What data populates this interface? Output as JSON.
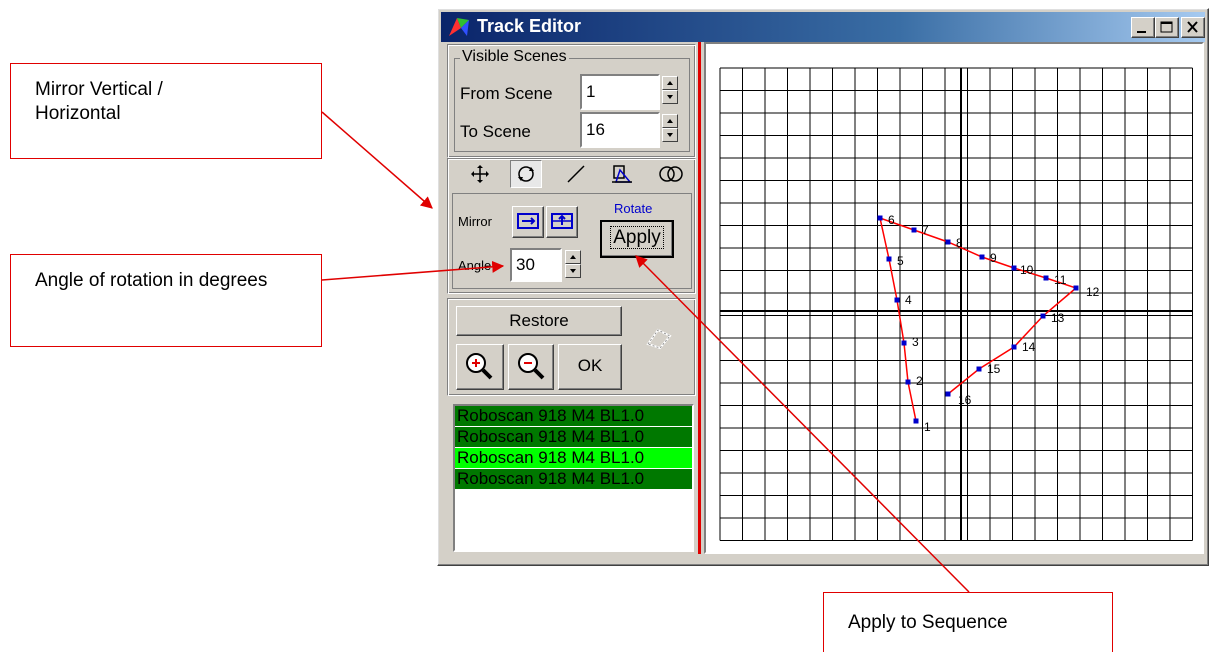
{
  "callouts": {
    "mirror": "Mirror Vertical / Horizontal",
    "angle": "Angle of rotation in degrees",
    "apply": "Apply to Sequence"
  },
  "window": {
    "title": "Track Editor",
    "icons": {
      "app": "app-logo-icon",
      "min": "minimize-icon",
      "max": "maximize-icon",
      "close": "close-icon"
    }
  },
  "visible_scenes": {
    "group_label": "Visible Scenes",
    "from_label": "From Scene",
    "from_value": "1",
    "to_label": "To Scene",
    "to_value": "16"
  },
  "tools": [
    "move-tool-icon",
    "rotate-tool-icon",
    "line-tool-icon",
    "skew-tool-icon",
    "circles-tool-icon"
  ],
  "rotate_panel": {
    "mirror_label": "Mirror",
    "rotate_label": "Rotate",
    "apply_label": "Apply",
    "angle_label": "Angle",
    "angle_value": "30"
  },
  "actions": {
    "restore_label": "Restore",
    "ok_label": "OK",
    "zoom_in": "zoom-in-icon",
    "zoom_out": "zoom-out-icon",
    "preview": "shape-preview-icon"
  },
  "tracks": [
    {
      "label": "Roboscan 918 M4 BL1.0",
      "selected": false
    },
    {
      "label": "Roboscan 918 M4 BL1.0",
      "selected": false
    },
    {
      "label": "Roboscan 918 M4 BL1.0",
      "selected": true
    },
    {
      "label": "Roboscan 918 M4 BL1.0",
      "selected": false
    }
  ],
  "track_points": [
    {
      "label": "1"
    },
    {
      "label": "2"
    },
    {
      "label": "3"
    },
    {
      "label": "4"
    },
    {
      "label": "5"
    },
    {
      "label": "6"
    },
    {
      "label": "7"
    },
    {
      "label": "8"
    },
    {
      "label": "9"
    },
    {
      "label": "10"
    },
    {
      "label": "11"
    },
    {
      "label": "12"
    },
    {
      "label": "13"
    },
    {
      "label": "14"
    },
    {
      "label": "15"
    },
    {
      "label": "16"
    }
  ],
  "colors": {
    "track_line": "#ff0000",
    "point": "#0000cc",
    "grid": "#000000",
    "accent": "#e00000"
  }
}
